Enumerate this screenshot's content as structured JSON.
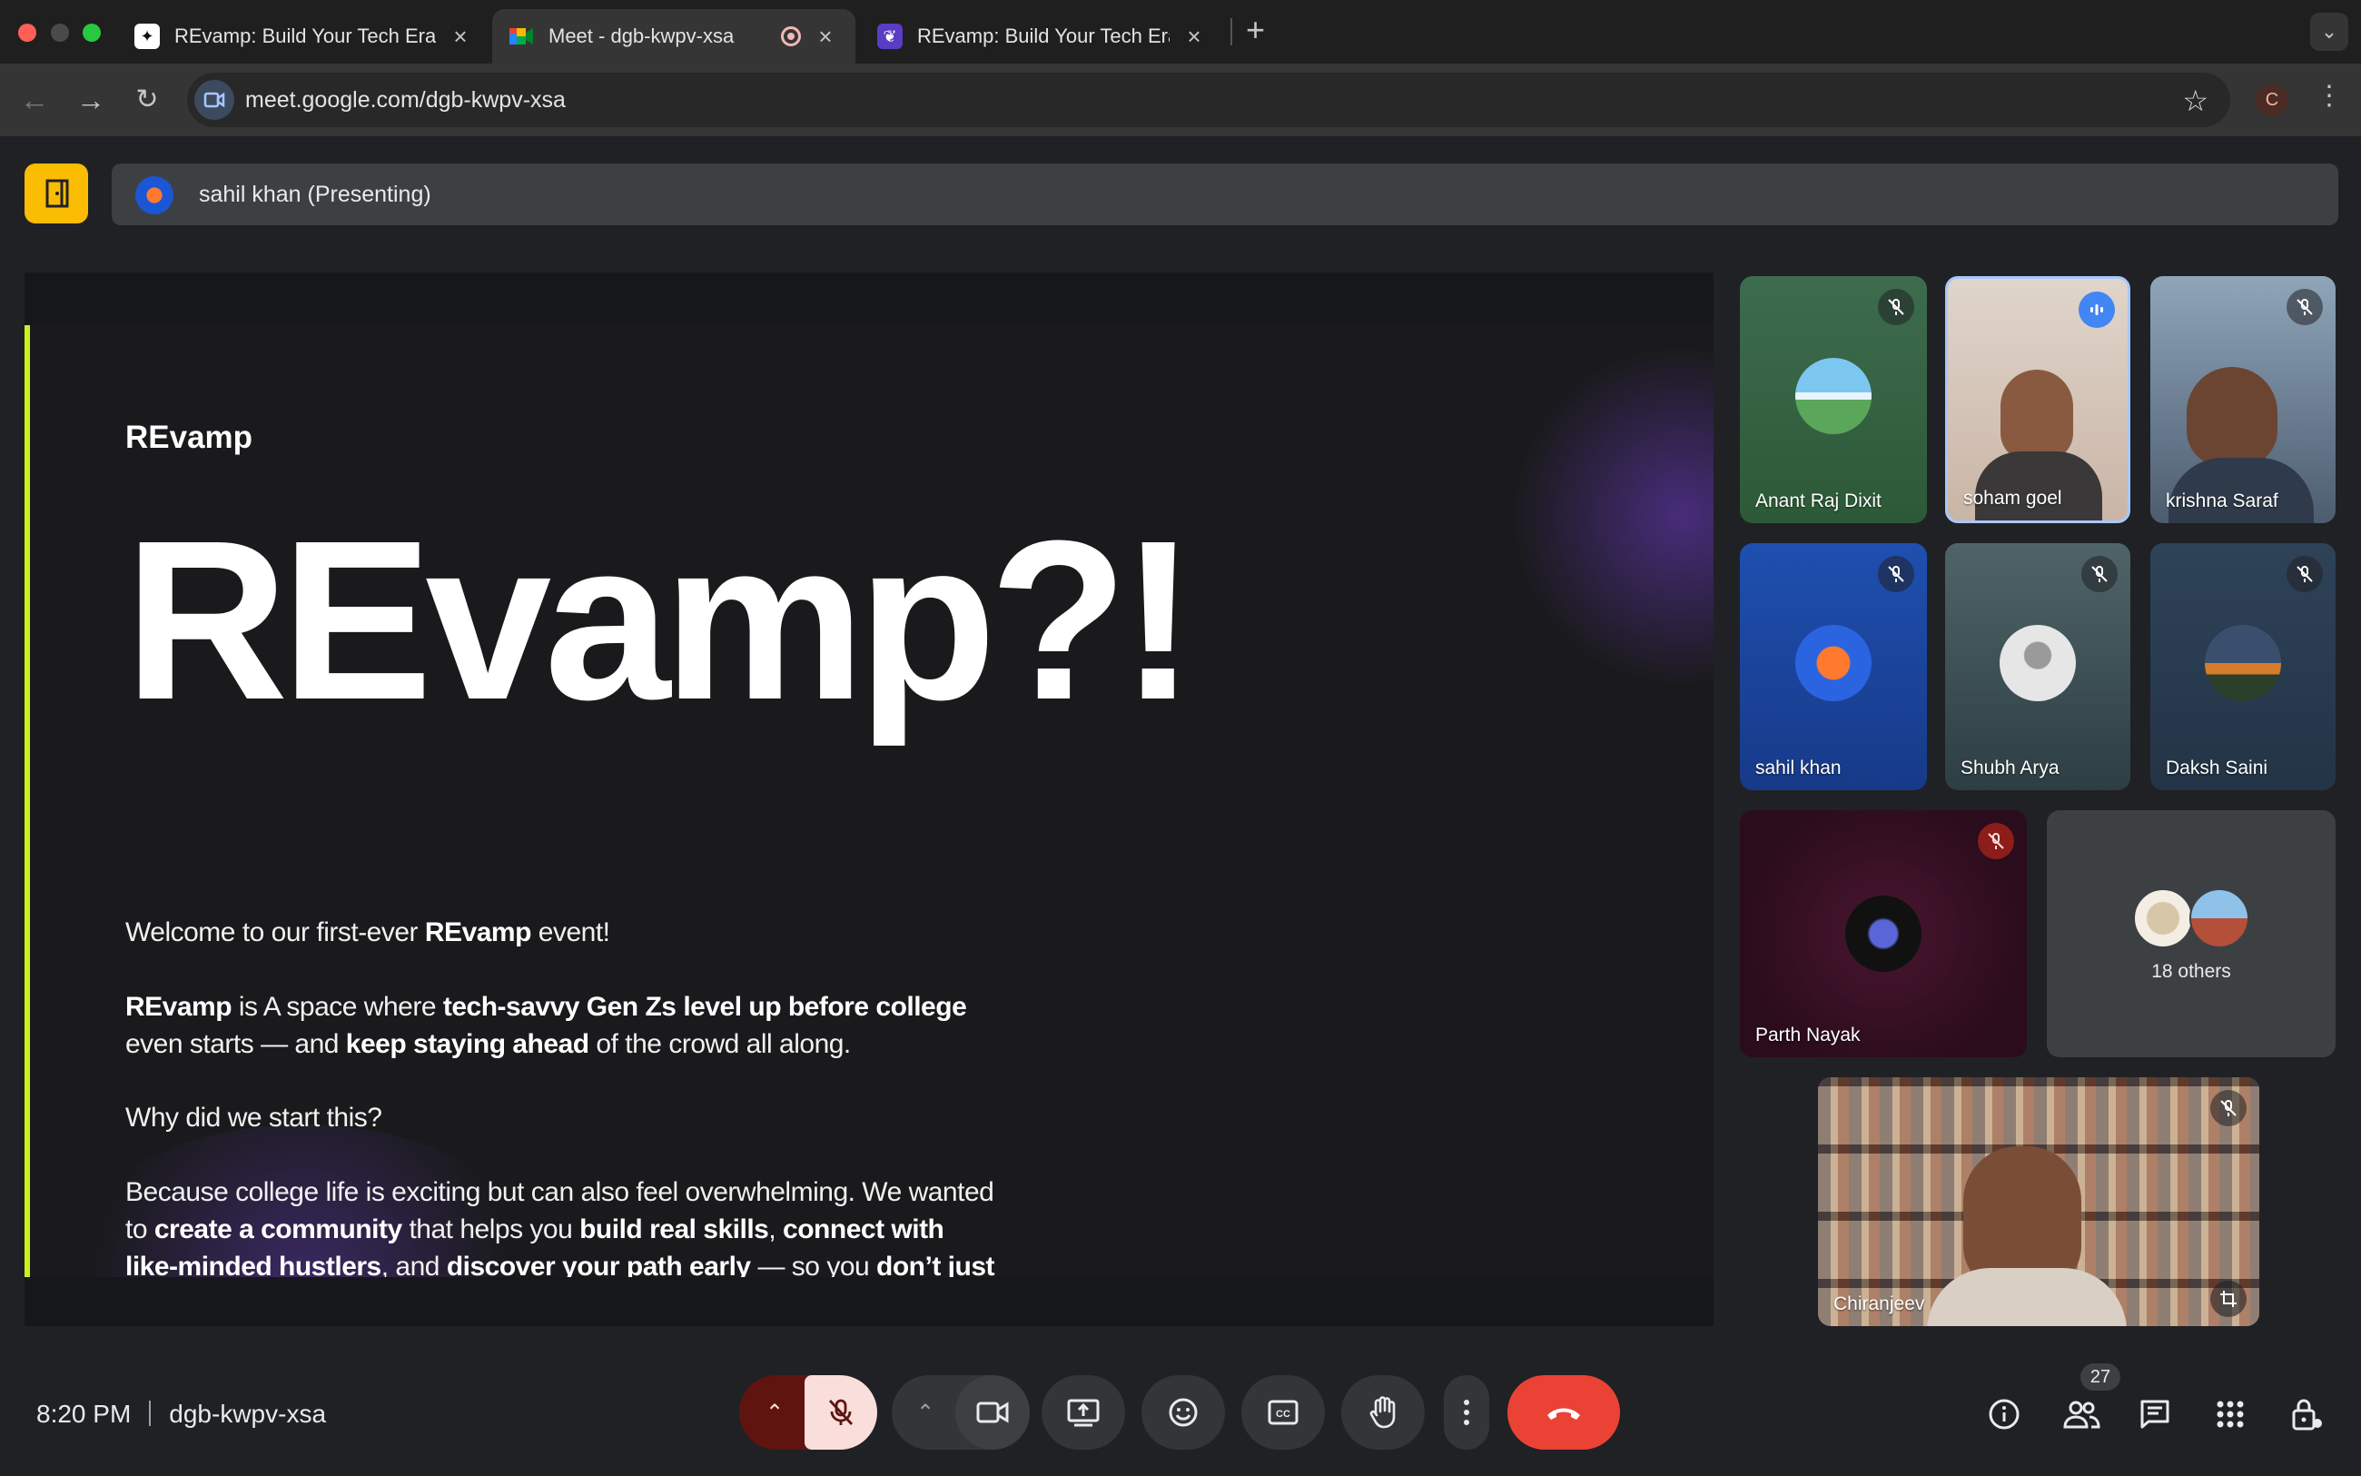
{
  "browser": {
    "tabs": [
      {
        "title": "REvamp: Build Your Tech Era",
        "active": false
      },
      {
        "title": "Meet - dgb-kwpv-xsa",
        "active": true
      },
      {
        "title": "REvamp: Build Your Tech Era",
        "active": false
      }
    ],
    "url": "meet.google.com/dgb-kwpv-xsa",
    "profile_initial": "C"
  },
  "meet": {
    "presenting_label": "sahil khan (Presenting)",
    "meeting_time": "8:20 PM",
    "meeting_code": "dgb-kwpv-xsa",
    "participant_count": "27",
    "others_label": "18 others"
  },
  "slide": {
    "brand": "REvamp",
    "title": "REvamp?!",
    "welcome": {
      "pre": "Welcome to our first-ever ",
      "bold": "REvamp",
      "post": " event!"
    },
    "intro": {
      "b1": "REvamp",
      "t1": " is A space where ",
      "b2": "tech-savvy Gen Zs level up before college",
      "t2": " even starts — and ",
      "b3": "keep staying ahead",
      "t3": " of the crowd all along."
    },
    "question": "Why did we start this?",
    "answer": {
      "t1": "Because college life is exciting but can also feel overwhelming. We wanted to ",
      "b1": "create a community",
      "t2": " that helps you ",
      "b2": "build real skills",
      "t3": ", ",
      "b3": "connect with like-minded hustlers",
      "t4": ", and ",
      "b4": "discover your path early",
      "t5": " — so you ",
      "b5": "don’t just survive college, you thrive",
      "t6": "."
    }
  },
  "participants": [
    {
      "name": "Anant Raj Dixit",
      "muted": true
    },
    {
      "name": "soham goel",
      "speaking": true
    },
    {
      "name": "krishna Saraf",
      "muted": true
    },
    {
      "name": "sahil khan",
      "muted": true
    },
    {
      "name": "Shubh Arya",
      "muted": true
    },
    {
      "name": "Daksh Saini",
      "muted": true
    },
    {
      "name": "Parth Nayak",
      "muted": true
    },
    {
      "name": "Chiranjeev",
      "muted": true
    }
  ],
  "colors": {
    "accent_yellow": "#fbbc04",
    "slide_accent_bar": "#c9f21a",
    "end_call_red": "#ea4335",
    "mic_off_pink": "#f9dedc"
  }
}
